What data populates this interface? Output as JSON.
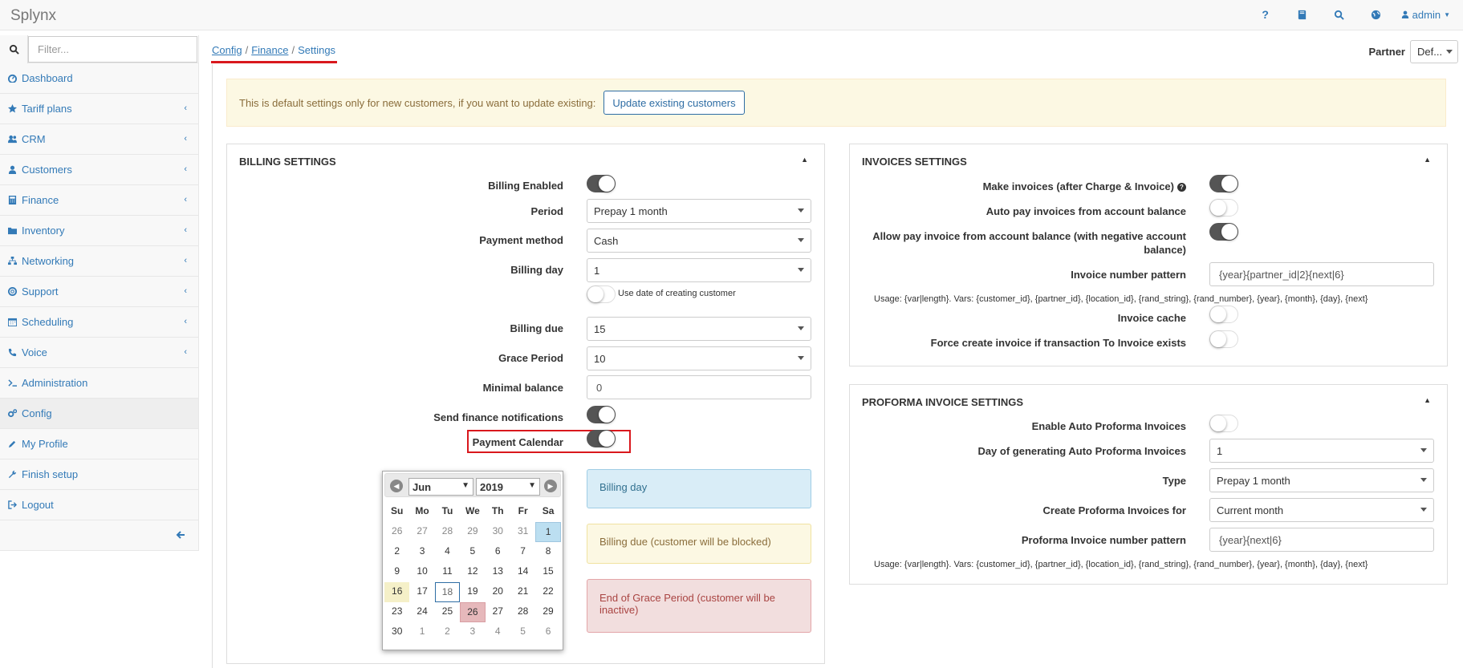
{
  "app": {
    "brand": "Splynx"
  },
  "topbar": {
    "icons": [
      "help-icon",
      "book-icon",
      "search-icon",
      "globe-icon"
    ],
    "user_label": "admin"
  },
  "sidebar": {
    "filter_placeholder": "Filter...",
    "items": [
      {
        "label": "Dashboard",
        "icon": "dashboard-icon",
        "has_submenu": false
      },
      {
        "label": "Tariff plans",
        "icon": "star-icon",
        "has_submenu": true
      },
      {
        "label": "CRM",
        "icon": "users-icon",
        "has_submenu": true
      },
      {
        "label": "Customers",
        "icon": "user-icon",
        "has_submenu": true
      },
      {
        "label": "Finance",
        "icon": "calculator-icon",
        "has_submenu": true
      },
      {
        "label": "Inventory",
        "icon": "folder-icon",
        "has_submenu": true
      },
      {
        "label": "Networking",
        "icon": "sitemap-icon",
        "has_submenu": true
      },
      {
        "label": "Support",
        "icon": "lifebuoy-icon",
        "has_submenu": true
      },
      {
        "label": "Scheduling",
        "icon": "calendar-icon",
        "has_submenu": true
      },
      {
        "label": "Voice",
        "icon": "phone-icon",
        "has_submenu": true
      },
      {
        "label": "Administration",
        "icon": "terminal-icon",
        "has_submenu": false
      },
      {
        "label": "Config",
        "icon": "cogs-icon",
        "has_submenu": false
      },
      {
        "label": "My Profile",
        "icon": "pencil-icon",
        "has_submenu": false
      },
      {
        "label": "Finish setup",
        "icon": "wrench-icon",
        "has_submenu": false
      },
      {
        "label": "Logout",
        "icon": "logout-icon",
        "has_submenu": false
      }
    ]
  },
  "breadcrumb": {
    "config": "Config",
    "finance": "Finance",
    "settings": "Settings",
    "sep": "/"
  },
  "partner": {
    "label": "Partner",
    "value": "Def..."
  },
  "alert": {
    "text": "This is default settings only for new customers, if you want to update existing:",
    "button": "Update existing customers"
  },
  "billing": {
    "title": "BILLING SETTINGS",
    "billing_enabled": {
      "label": "Billing Enabled",
      "on": true
    },
    "period": {
      "label": "Period",
      "value": "Prepay 1 month"
    },
    "payment_method": {
      "label": "Payment method",
      "value": "Cash"
    },
    "billing_day": {
      "label": "Billing day",
      "value": "1",
      "use_date_label": "Use date of creating customer"
    },
    "billing_due": {
      "label": "Billing due",
      "value": "15"
    },
    "grace_period": {
      "label": "Grace Period",
      "value": "10"
    },
    "minimal_balance": {
      "label": "Minimal balance",
      "value": "0"
    },
    "send_notifications": {
      "label": "Send finance notifications",
      "on": true
    },
    "payment_calendar": {
      "label": "Payment Calendar",
      "on": true
    },
    "legend": {
      "billing_day": "Billing day",
      "billing_due": "Billing due (customer will be blocked)",
      "grace": "End of Grace Period (customer will be inactive)"
    }
  },
  "calendar": {
    "month": "Jun",
    "year": "2019",
    "weekdays": [
      "Su",
      "Mo",
      "Tu",
      "We",
      "Th",
      "Fr",
      "Sa"
    ],
    "weeks": [
      [
        "26",
        "27",
        "28",
        "29",
        "30",
        "31",
        "1"
      ],
      [
        "2",
        "3",
        "4",
        "5",
        "6",
        "7",
        "8"
      ],
      [
        "9",
        "10",
        "11",
        "12",
        "13",
        "14",
        "15"
      ],
      [
        "16",
        "17",
        "18",
        "19",
        "20",
        "21",
        "22"
      ],
      [
        "23",
        "24",
        "25",
        "26",
        "27",
        "28",
        "29"
      ],
      [
        "30",
        "1",
        "2",
        "3",
        "4",
        "5",
        "6"
      ]
    ],
    "colors": {
      "billing": "#bcdff1",
      "due": "#f5f0c8",
      "grace": "#e6b8bb"
    }
  },
  "invoices": {
    "title": "INVOICES SETTINGS",
    "make_invoices": {
      "label": "Make invoices (after Charge & Invoice)",
      "on": true
    },
    "auto_pay": {
      "label": "Auto pay invoices from account balance",
      "on": false
    },
    "allow_negative": {
      "label": "Allow pay invoice from account balance (with negative account balance)",
      "on": true
    },
    "number_pattern": {
      "label": "Invoice number pattern",
      "value": "{year}{partner_id|2}{next|6}"
    },
    "usage": "Usage: {var|length}. Vars: {customer_id}, {partner_id}, {location_id}, {rand_string}, {rand_number}, {year}, {month}, {day}, {next}",
    "cache": {
      "label": "Invoice cache",
      "on": false
    },
    "force_create": {
      "label": "Force create invoice if transaction To Invoice exists",
      "on": false
    }
  },
  "proforma": {
    "title": "PROFORMA INVOICE SETTINGS",
    "enable_auto": {
      "label": "Enable Auto Proforma Invoices",
      "on": false
    },
    "day_generating": {
      "label": "Day of generating Auto Proforma Invoices",
      "value": "1"
    },
    "type": {
      "label": "Type",
      "value": "Prepay 1 month"
    },
    "create_for": {
      "label": "Create Proforma Invoices for",
      "value": "Current month"
    },
    "number_pattern": {
      "label": "Proforma Invoice number pattern",
      "value": "{year}{next|6}"
    },
    "usage": "Usage: {var|length}. Vars: {customer_id}, {partner_id}, {location_id}, {rand_string}, {rand_number}, {year}, {month}, {day}, {next}"
  }
}
